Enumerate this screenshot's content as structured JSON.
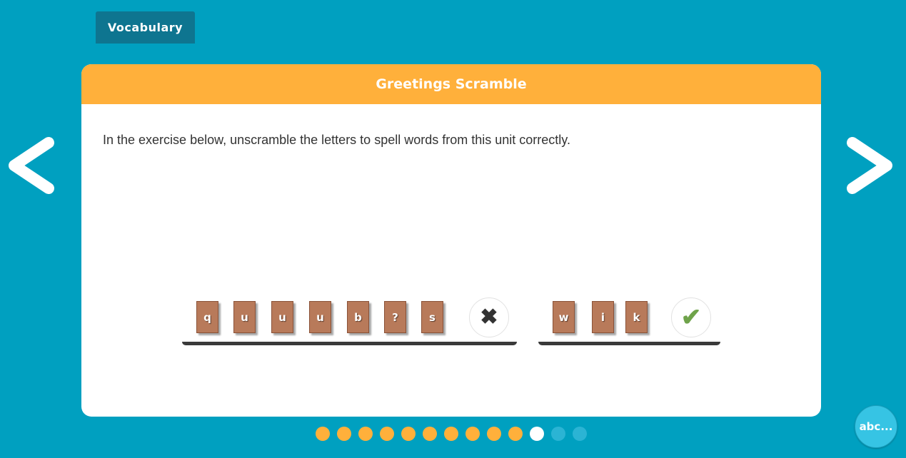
{
  "tab": {
    "label": "Vocabulary"
  },
  "navigation": {
    "prev_icon": "chevron-left-icon",
    "next_icon": "chevron-right-icon"
  },
  "activity": {
    "title": "Greetings Scramble",
    "instructions": "In the exercise below, unscramble the letters to spell words from this unit correctly.",
    "words": [
      {
        "letters": [
          "q",
          "u",
          "u",
          "u",
          "b",
          "?",
          "s"
        ],
        "status": "incorrect",
        "status_icon": "close-icon",
        "status_glyph": "✖"
      },
      {
        "letters": [
          "w",
          "i",
          "k"
        ],
        "status": "correct",
        "status_icon": "check-icon",
        "status_glyph": "✔"
      }
    ]
  },
  "pagination": {
    "total": 13,
    "current": 11,
    "completed": 10,
    "colors": {
      "completed": "#ffb03b",
      "current": "#ffffff",
      "upcoming": "#2bb4d4"
    }
  },
  "abc_button": {
    "label": "abc..."
  },
  "colors": {
    "background": "#00a0c0",
    "tab": "#0e7590",
    "header": "#ffb03b",
    "tile": "#b87a5a",
    "correct": "#6fa34a"
  }
}
